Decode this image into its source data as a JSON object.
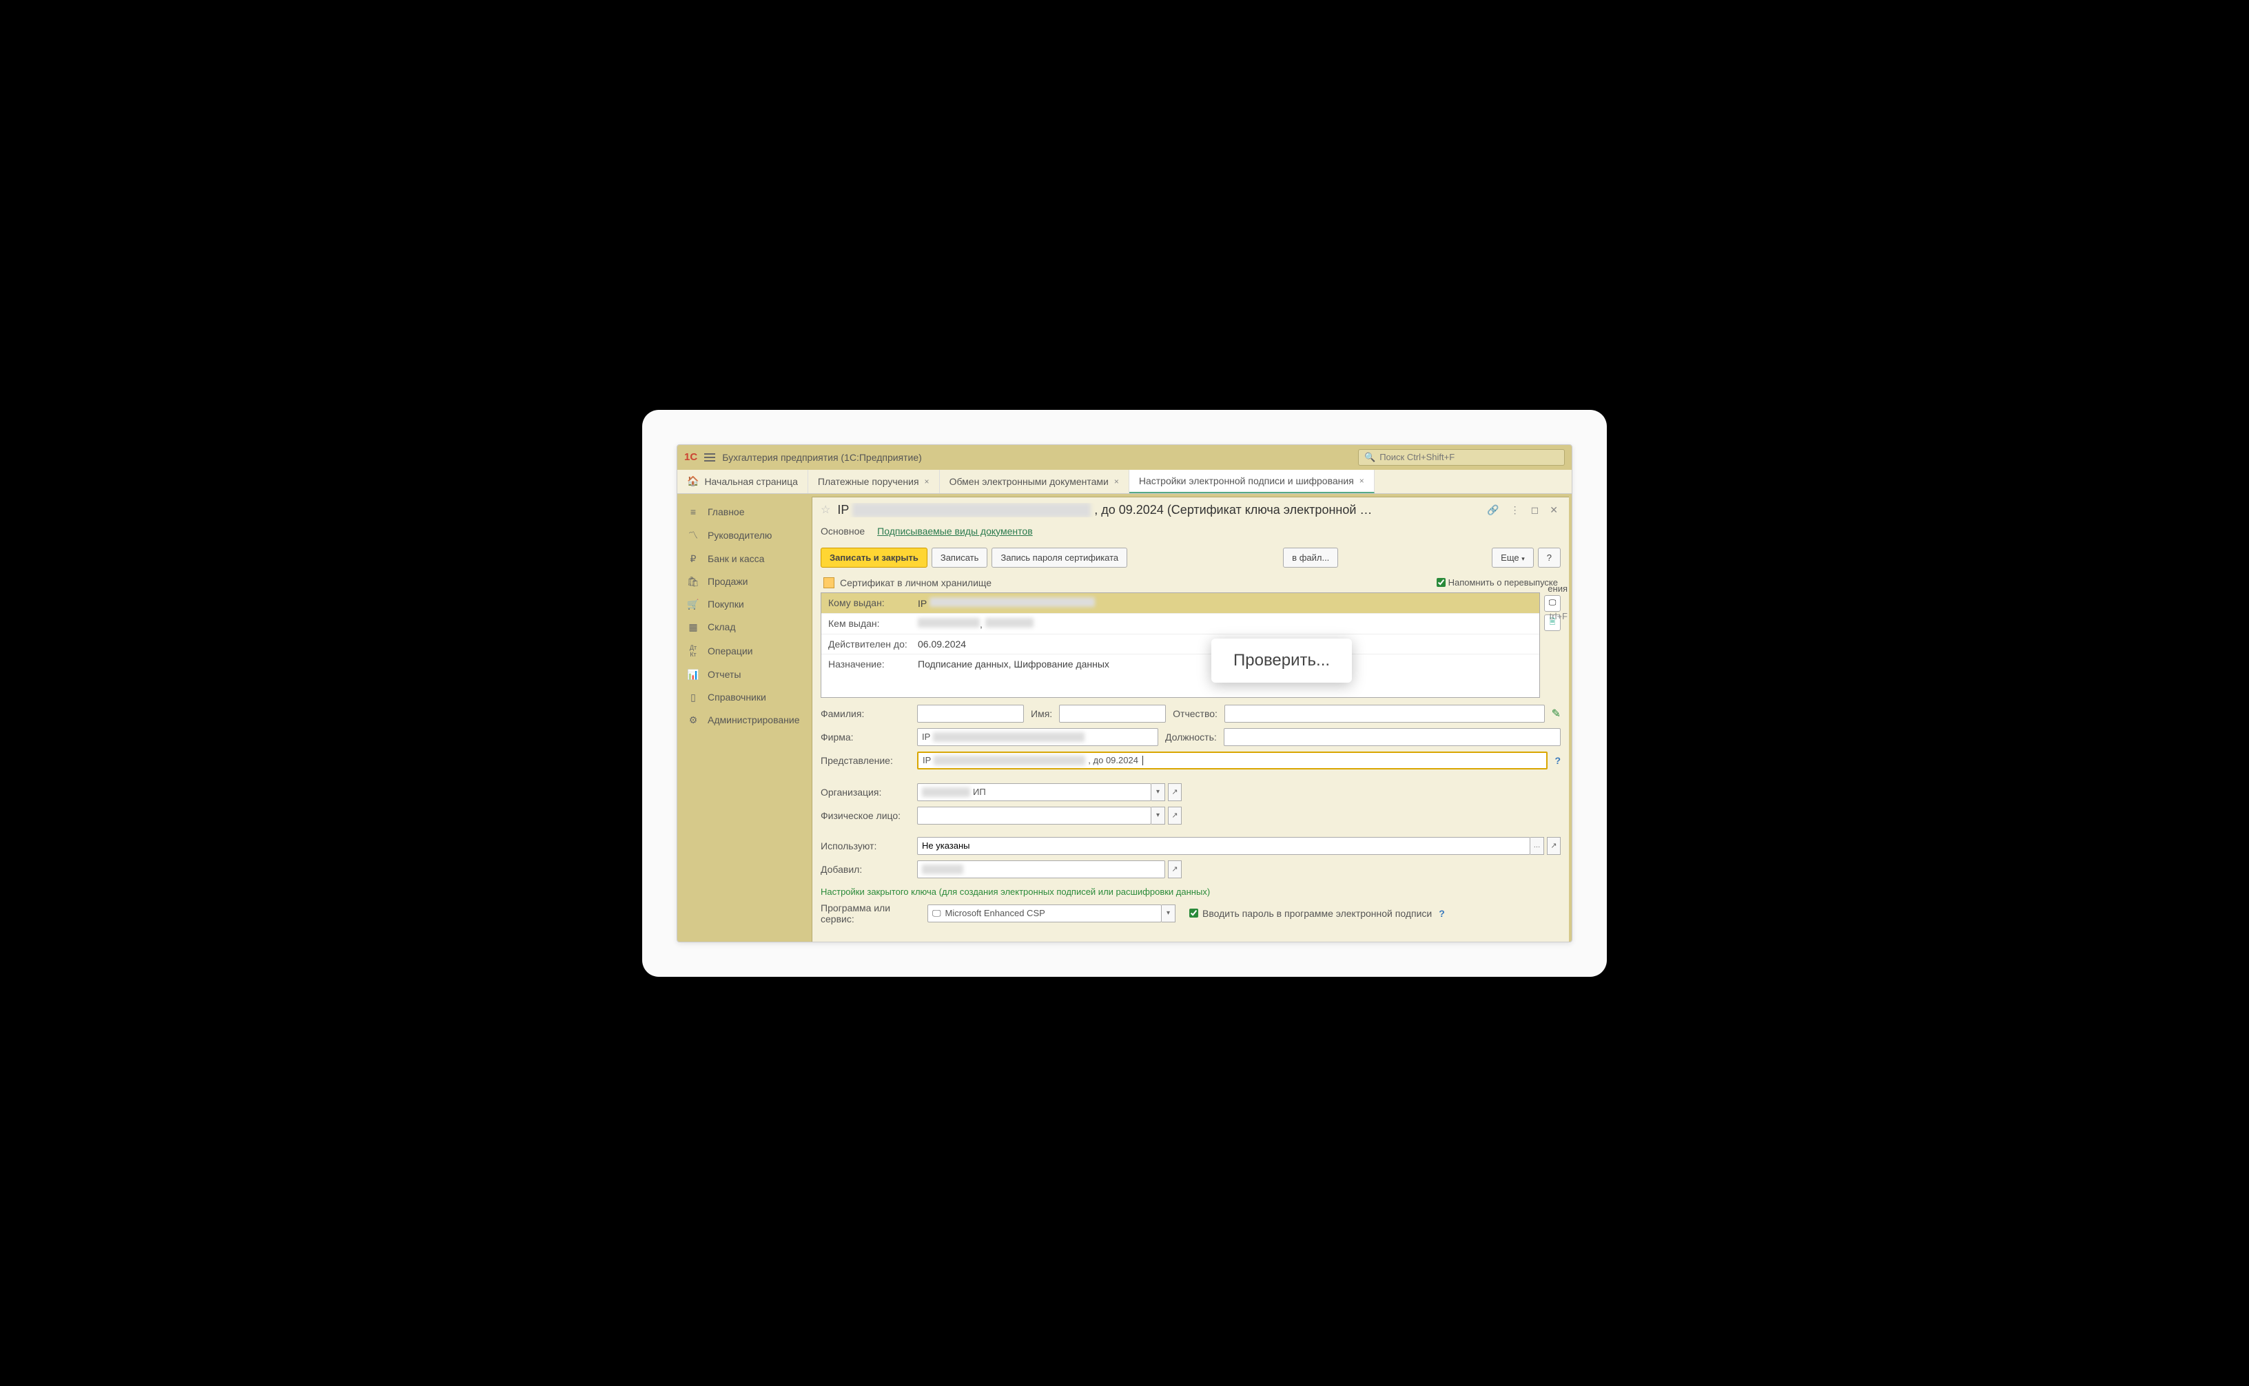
{
  "app": {
    "title": "Бухгалтерия предприятия  (1С:Предприятие)",
    "search_placeholder": "Поиск Ctrl+Shift+F"
  },
  "tabs": {
    "home": "Начальная страница",
    "items": [
      {
        "label": "Платежные поручения"
      },
      {
        "label": "Обмен электронными документами"
      },
      {
        "label": "Настройки электронной подписи и шифрования",
        "active": true
      }
    ]
  },
  "sidebar": [
    {
      "icon": "≡",
      "label": "Главное"
    },
    {
      "icon": "📈",
      "label": "Руководителю"
    },
    {
      "icon": "₽",
      "label": "Банк и касса"
    },
    {
      "icon": "🛍",
      "label": "Продажи"
    },
    {
      "icon": "🛒",
      "label": "Покупки"
    },
    {
      "icon": "☰",
      "label": "Склад"
    },
    {
      "icon": "Дт",
      "label": "Операции"
    },
    {
      "icon": "📊",
      "label": "Отчеты"
    },
    {
      "icon": "📚",
      "label": "Справочники"
    },
    {
      "icon": "⚙",
      "label": "Администрирование"
    }
  ],
  "panel": {
    "title_prefix": "IP",
    "title_suffix": ", до 09.2024 (Сертификат ключа электронной …",
    "inner_tabs": {
      "main": "Основное",
      "docs": "Подписываемые виды документов"
    },
    "toolbar": {
      "save_close": "Записать и закрыть",
      "save": "Записать",
      "save_pwd": "Запись пароля сертификата",
      "to_file": "в файл...",
      "more": "Еще",
      "help": "?"
    },
    "cert_status": "Сертификат в личном хранилище",
    "remind": "Напомнить о перевыпуске",
    "cert": {
      "issued_to_label": "Кому выдан:",
      "issued_to": "IP",
      "issued_by_label": "Кем выдан:",
      "valid_label": "Действителен до:",
      "valid_value": "06.09.2024",
      "purpose_label": "Назначение:",
      "purpose_value": "Подписание данных, Шифрование данных"
    },
    "form": {
      "surname": "Фамилия:",
      "name": "Имя:",
      "patronymic": "Отчество:",
      "firm": "Фирма:",
      "firm_value": "IP",
      "position": "Должность:",
      "representation": "Представление:",
      "representation_prefix": "IP",
      "representation_suffix": ", до 09.2024",
      "organization": "Организация:",
      "organization_suffix": " ИП",
      "person": "Физическое лицо:",
      "users": "Используют:",
      "users_value": "Не указаны",
      "added": "Добавил:",
      "section": "Настройки закрытого ключа (для создания электронных подписей или расшифровки данных)",
      "program": "Программа или сервис:",
      "program_value": "Microsoft Enhanced CSP",
      "enter_pwd": "Вводить пароль в программе электронной подписи"
    }
  },
  "popup": "Проверить...",
  "side_text": {
    "a": "ения",
    "b": "trl+F"
  }
}
